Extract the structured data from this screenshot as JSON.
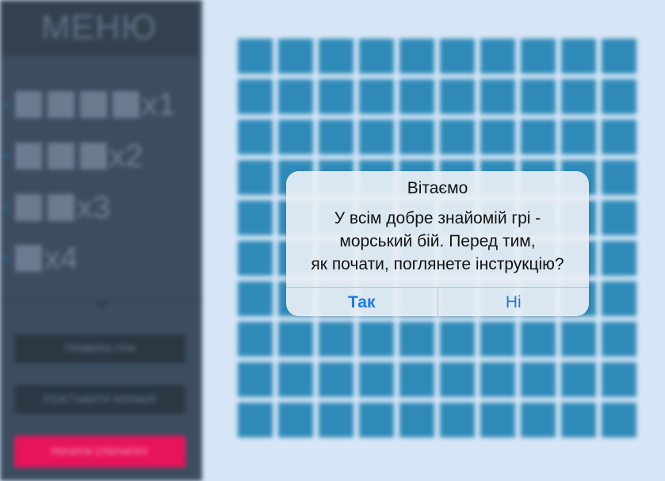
{
  "menu": {
    "title": "МЕНЮ",
    "ships": [
      {
        "cells": 4,
        "count": "x1"
      },
      {
        "cells": 3,
        "count": "x2"
      },
      {
        "cells": 2,
        "count": "x3"
      },
      {
        "cells": 1,
        "count": "x4"
      }
    ],
    "buttons": {
      "rules": "ПРАВИЛА ГРИ",
      "place": "РОЗСТАВИТИ КОРАБЛІ",
      "start": "ПОЧАТИ СПОЧАТКУ"
    }
  },
  "board": {
    "rows": 10,
    "cols": 10
  },
  "dialog": {
    "title": "Вітаємо",
    "message_lines": [
      "У всім добре знайомій грі -",
      "морський бій. Перед тим,",
      "як почати, поглянете інструкцію?"
    ],
    "yes_label": "Так",
    "no_label": "Ні"
  },
  "colors": {
    "accent": "#1a7ae6",
    "start_button": "#e8145a",
    "board_cell": "#2f8ab8"
  }
}
